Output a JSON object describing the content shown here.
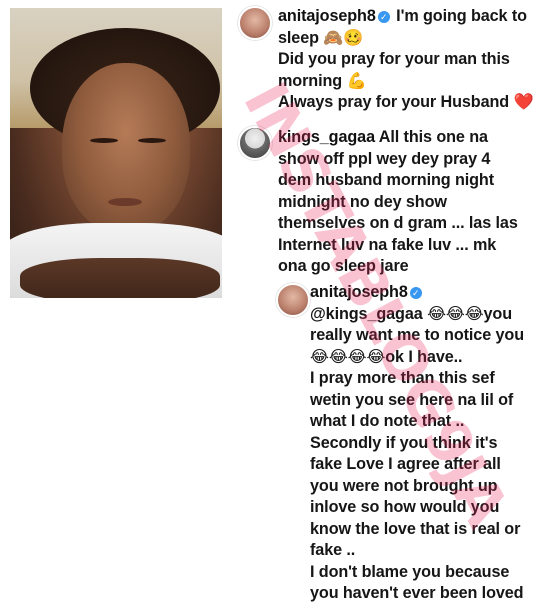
{
  "post": {
    "image_alt": "selfie photo"
  },
  "comments": [
    {
      "username": "anitajoseph8",
      "verified": true,
      "lines": [
        "I'm going back to",
        "sleep 🙈🥴",
        "Did you pray for your man this",
        "morning 💪",
        "Always pray for your Husband ❤️"
      ]
    },
    {
      "username": "kings_gagaa",
      "verified": false,
      "lines": [
        "All this one na",
        "show off ppl wey dey pray 4",
        "dem husband morning night",
        "midnight no dey show",
        "themselves on d gram ... las las",
        "Internet luv na fake luv ... mk",
        "ona go sleep jare"
      ]
    },
    {
      "username": "anitajoseph8",
      "verified": true,
      "mention": "@kings_gagaa",
      "lines": [
        "😂😂😂you",
        "really want me to notice you",
        "😂😂😂😂ok I have..",
        "I pray more than this sef",
        "wetin you see here na lil of",
        "what I do note that ..",
        "Secondly if you think it's",
        "fake Love I agree after all",
        "you were not brought up",
        "inlove so how would you",
        "know the love that is real or",
        "fake ..",
        "I don't blame you because",
        "you haven't ever been loved"
      ]
    }
  ],
  "watermark": "INSTABLOG9JA",
  "colors": {
    "verified": "#3897f0",
    "watermark": "#e8285f",
    "text": "#161616"
  }
}
